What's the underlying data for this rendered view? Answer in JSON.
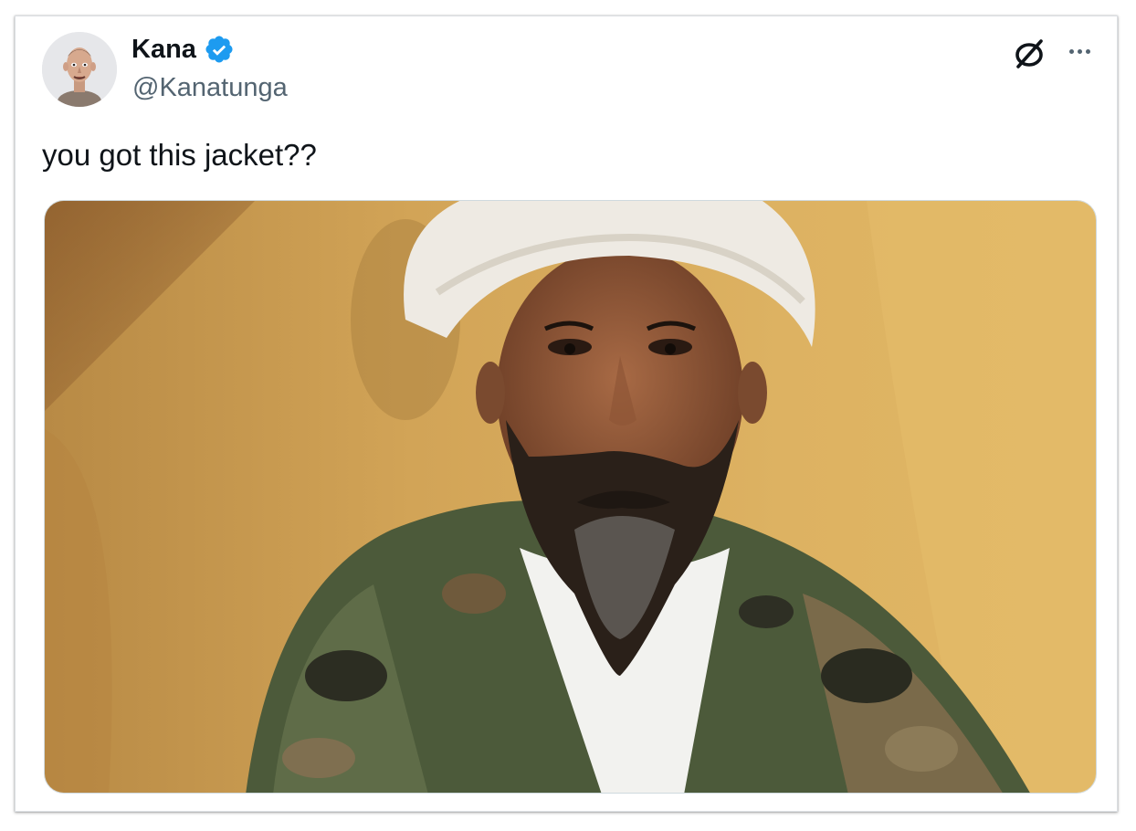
{
  "tweet": {
    "author": {
      "display_name": "Kana",
      "handle": "@Kanatunga",
      "verified": true,
      "avatar_icon": "cartoon-avatar"
    },
    "text": "you got this jacket??",
    "media": {
      "type": "photo"
    },
    "header_icons": [
      "x-logo-icon",
      "more-options-icon"
    ]
  },
  "colors": {
    "verified_blue": "#1d9bf0",
    "text_primary": "#0f1419",
    "text_secondary": "#536471",
    "border": "#cfd9de"
  }
}
